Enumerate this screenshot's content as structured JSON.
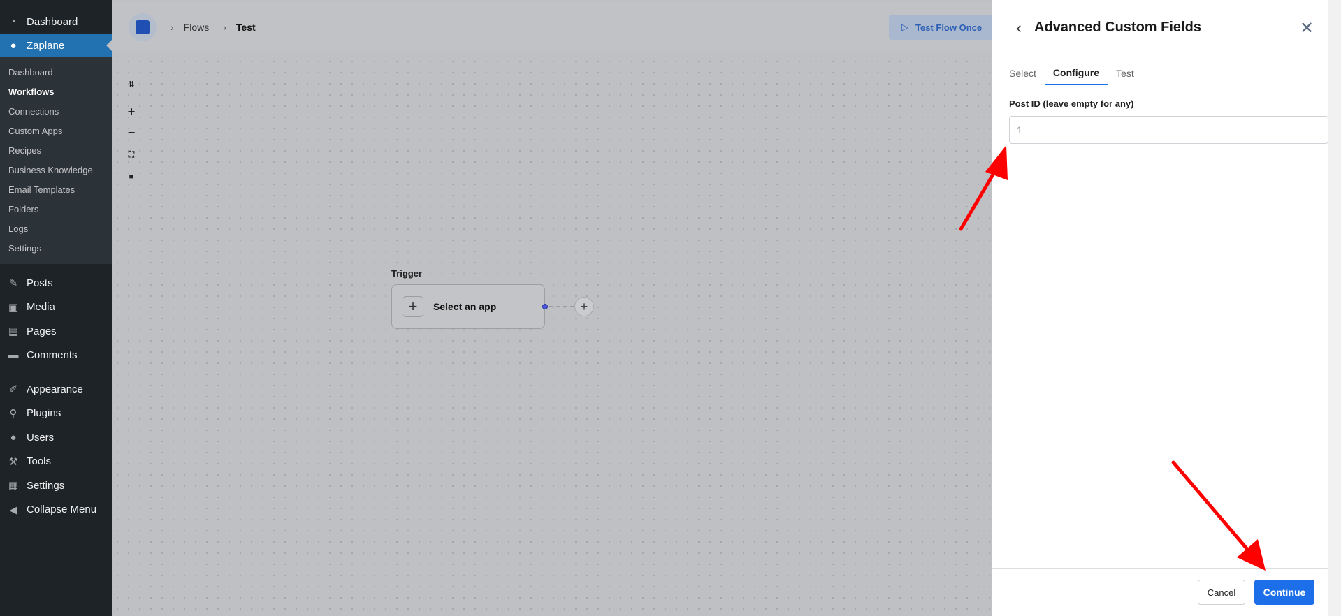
{
  "wp_sidebar": {
    "top_items": [
      {
        "label": "Dashboard",
        "icon": "dashboard-icon"
      },
      {
        "label": "Zaplane",
        "icon": "zaplane-icon"
      }
    ],
    "submenu": [
      "Dashboard",
      "Workflows",
      "Connections",
      "Custom Apps",
      "Recipes",
      "Business Knowledge",
      "Email Templates",
      "Folders",
      "Logs",
      "Settings"
    ],
    "current_submenu": "Workflows",
    "lower_items": [
      {
        "label": "Posts",
        "icon": "pin-icon"
      },
      {
        "label": "Media",
        "icon": "media-icon"
      },
      {
        "label": "Pages",
        "icon": "pages-icon"
      },
      {
        "label": "Comments",
        "icon": "comment-icon"
      },
      {
        "label": "Appearance",
        "icon": "brush-icon"
      },
      {
        "label": "Plugins",
        "icon": "plug-icon"
      },
      {
        "label": "Users",
        "icon": "user-icon"
      },
      {
        "label": "Tools",
        "icon": "wrench-icon"
      },
      {
        "label": "Settings",
        "icon": "settings-icon"
      },
      {
        "label": "Collapse Menu",
        "icon": "collapse-icon"
      }
    ]
  },
  "topbar": {
    "breadcrumb": [
      "Flows",
      "Test"
    ],
    "test_flow_label": "Test Flow Once"
  },
  "canvas": {
    "trigger_label": "Trigger",
    "trigger_node_text": "Select an app"
  },
  "panel": {
    "title": "Advanced Custom Fields",
    "tabs": [
      "Select",
      "Configure",
      "Test"
    ],
    "active_tab": "Configure",
    "field_label": "Post ID (leave empty for any)",
    "field_placeholder": "1",
    "cancel_label": "Cancel",
    "continue_label": "Continue"
  },
  "colors": {
    "accent": "#1c6fe8",
    "wp_sidebar": "#1d2327",
    "wp_active": "#2271b1",
    "annotation_arrow": "#ff0000"
  }
}
